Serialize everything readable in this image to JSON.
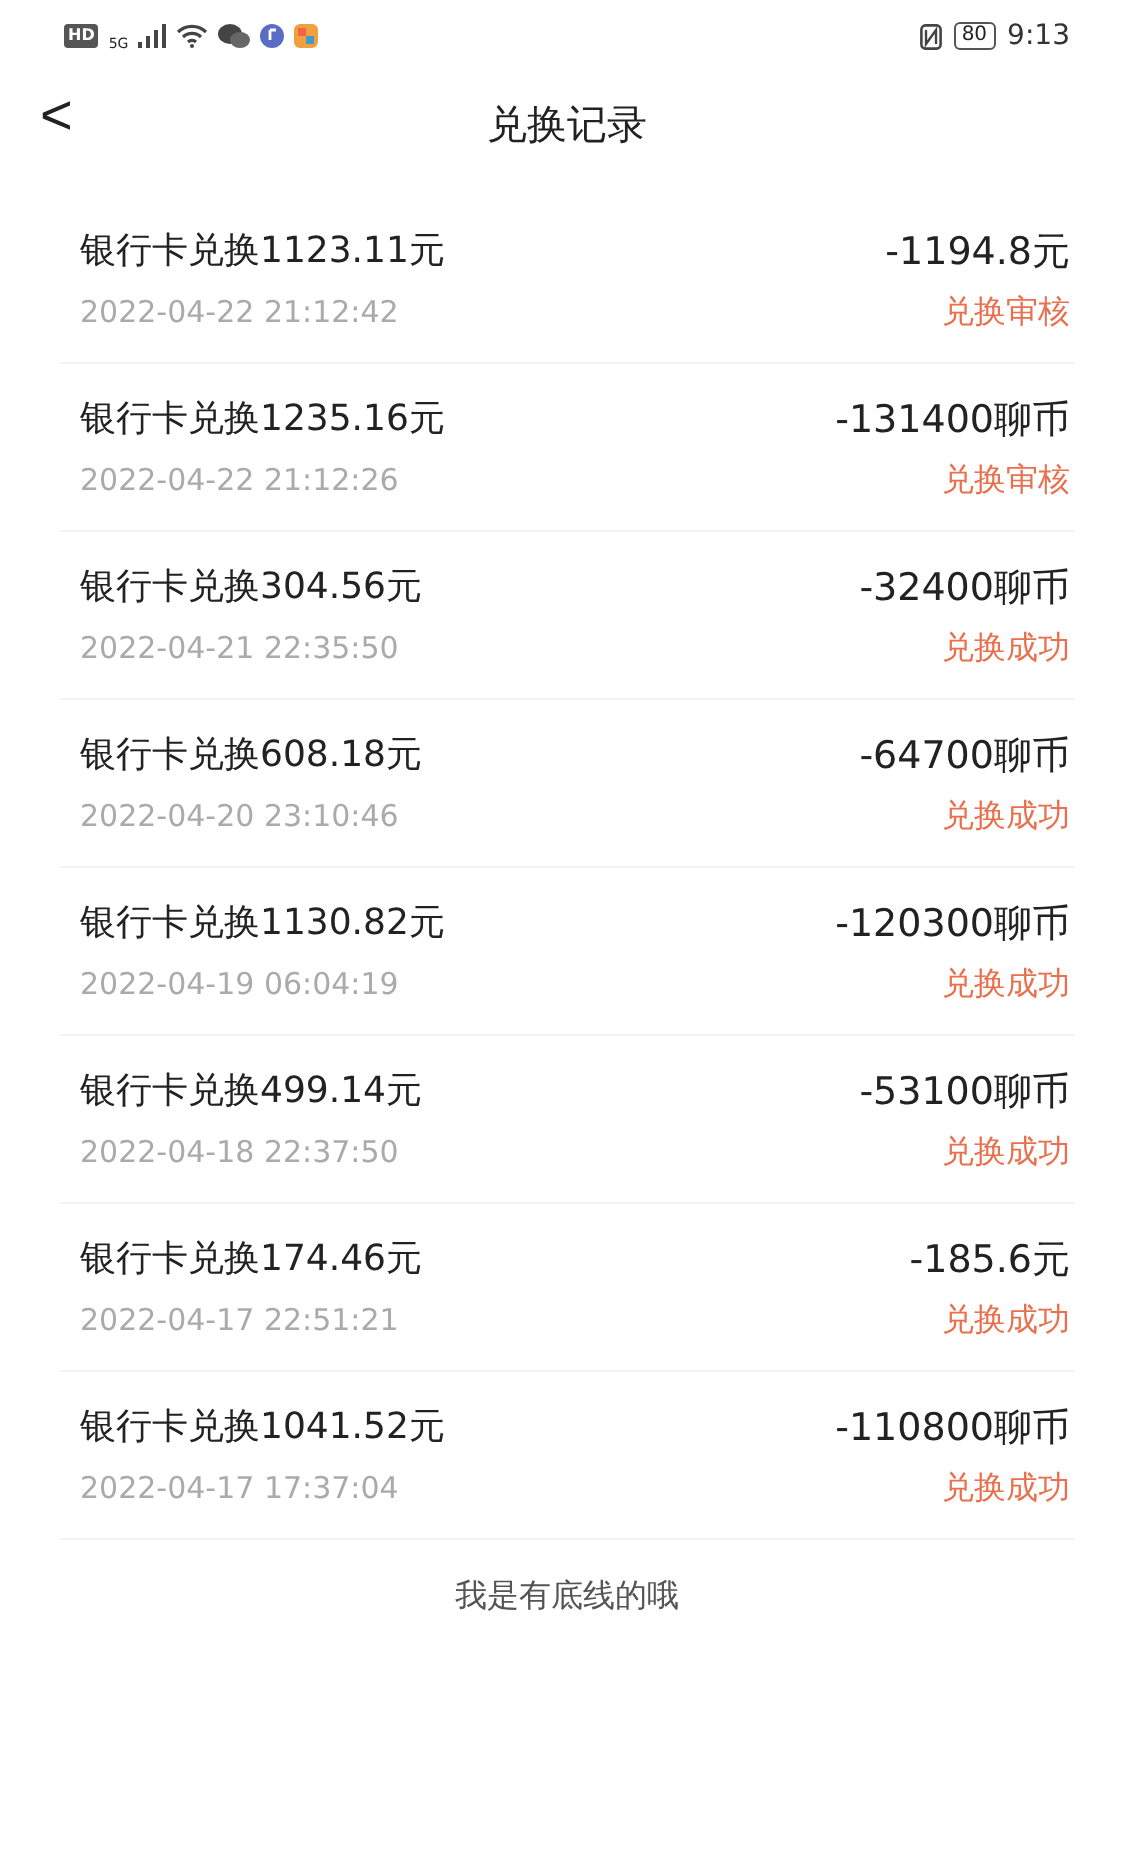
{
  "status_bar": {
    "hd": "HD",
    "network": "5G",
    "battery": "80",
    "time": "9:13"
  },
  "header": {
    "back": "<",
    "title": "兑换记录"
  },
  "records": [
    {
      "title": "银行卡兑换1123.11元",
      "time": "2022-04-22 21:12:42",
      "amount": "-1194.8元",
      "status": "兑换审核"
    },
    {
      "title": "银行卡兑换1235.16元",
      "time": "2022-04-22 21:12:26",
      "amount": "-131400聊币",
      "status": "兑换审核"
    },
    {
      "title": "银行卡兑换304.56元",
      "time": "2022-04-21 22:35:50",
      "amount": "-32400聊币",
      "status": "兑换成功"
    },
    {
      "title": "银行卡兑换608.18元",
      "time": "2022-04-20 23:10:46",
      "amount": "-64700聊币",
      "status": "兑换成功"
    },
    {
      "title": "银行卡兑换1130.82元",
      "time": "2022-04-19 06:04:19",
      "amount": "-120300聊币",
      "status": "兑换成功"
    },
    {
      "title": "银行卡兑换499.14元",
      "time": "2022-04-18 22:37:50",
      "amount": "-53100聊币",
      "status": "兑换成功"
    },
    {
      "title": "银行卡兑换174.46元",
      "time": "2022-04-17 22:51:21",
      "amount": "-185.6元",
      "status": "兑换成功"
    },
    {
      "title": "银行卡兑换1041.52元",
      "time": "2022-04-17 17:37:04",
      "amount": "-110800聊币",
      "status": "兑换成功"
    }
  ],
  "footer": "我是有底线的哦"
}
